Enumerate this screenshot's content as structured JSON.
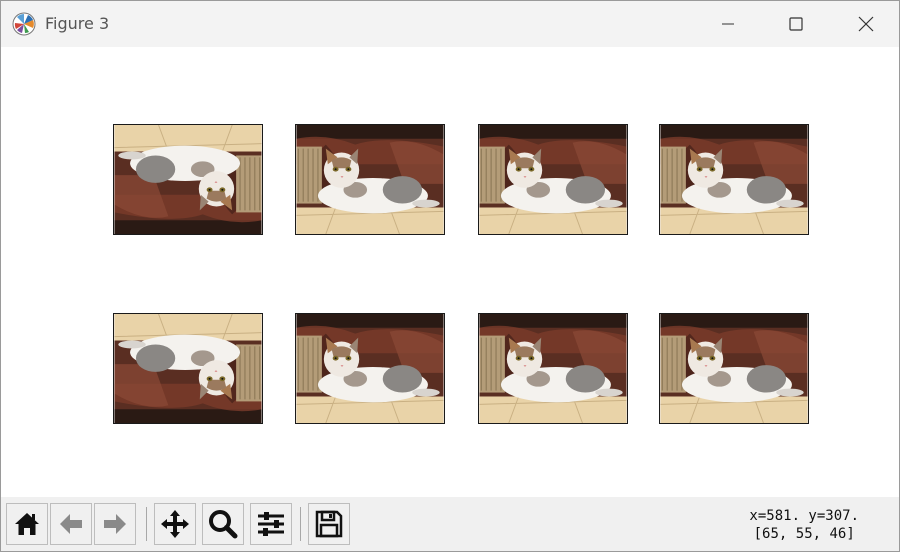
{
  "window": {
    "title": "Figure 3",
    "app_icon": "matplotlib-logo-icon",
    "controls": [
      "minimize-icon",
      "maximize-icon",
      "close-icon"
    ]
  },
  "figure": {
    "rows": 2,
    "columns": 4,
    "panels": [
      {
        "row": 1,
        "col": 1,
        "content": "cat photo rotated 180°"
      },
      {
        "row": 1,
        "col": 2,
        "content": "cat photo"
      },
      {
        "row": 1,
        "col": 3,
        "content": "cat photo"
      },
      {
        "row": 1,
        "col": 4,
        "content": "cat photo"
      },
      {
        "row": 2,
        "col": 1,
        "content": "cat photo rotated 180°"
      },
      {
        "row": 2,
        "col": 2,
        "content": "cat photo"
      },
      {
        "row": 2,
        "col": 3,
        "content": "cat photo"
      },
      {
        "row": 2,
        "col": 4,
        "content": "cat photo"
      }
    ]
  },
  "toolbar": {
    "buttons": [
      "home-icon",
      "back-icon",
      "forward-icon",
      "pan-icon",
      "zoom-icon",
      "configure-subplots-icon",
      "save-icon"
    ]
  },
  "status": {
    "cursor": "x=581. y=307.",
    "pixel_value": "[65, 55, 46]"
  }
}
